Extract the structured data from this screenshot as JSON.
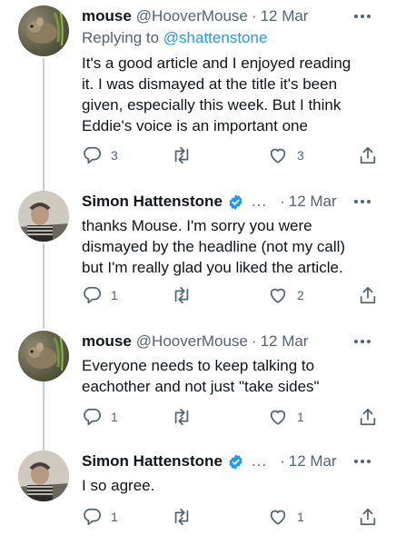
{
  "tweets": [
    {
      "name": "mouse",
      "handle": "@HooverMouse",
      "separator": "·",
      "time": "12 Mar",
      "reply_label": "Replying to",
      "reply_mention": "@shattenstone",
      "lines": [
        "It's a good article and I enjoyed reading",
        "it. I was dismayed at the title it's been",
        "given, especially this week. But I think",
        "Eddie's voice is an important one"
      ],
      "replies": "3",
      "retweets": "",
      "likes": "3"
    },
    {
      "name": "Simon Hattenstone",
      "ellipsis": "...",
      "separator": "·",
      "time": "12 Mar",
      "lines": [
        "thanks Mouse. I'm sorry you were",
        "dismayed by the headline (not my call)",
        "but I'm really glad you liked the article."
      ],
      "replies": "1",
      "retweets": "",
      "likes": "2"
    },
    {
      "name": "mouse",
      "handle": "@HooverMouse",
      "separator": "·",
      "time": "12 Mar",
      "lines": [
        "Everyone needs to keep talking to",
        "eachother and not just \"take sides\""
      ],
      "replies": "1",
      "retweets": "",
      "likes": "1"
    },
    {
      "name": "Simon Hattenstone",
      "ellipsis": "...",
      "separator": "·",
      "time": "12 Mar",
      "lines": [
        "I so agree."
      ],
      "replies": "1",
      "retweets": "",
      "likes": "1"
    }
  ],
  "icons": {
    "reply": "reply-icon",
    "retweet": "retweet-icon",
    "like": "heart-icon",
    "share": "share-icon",
    "more": "more-icon",
    "verified": "verified-badge-icon"
  },
  "colors": {
    "text": "#0f1419",
    "secondary": "#536471",
    "accent": "#1d9bf0",
    "thread_line": "#c4cfd6"
  }
}
